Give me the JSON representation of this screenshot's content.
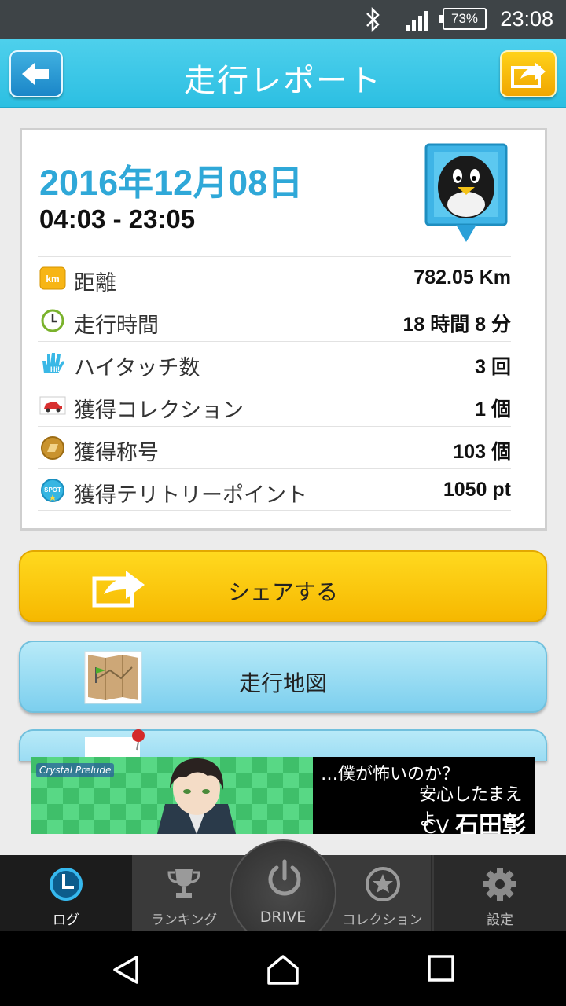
{
  "status_bar": {
    "battery": "73%",
    "time": "23:08"
  },
  "header": {
    "title": "走行レポート"
  },
  "report": {
    "date": "2016年12月08日",
    "time_range": "04:03 - 23:05",
    "stats": [
      {
        "icon": "km-icon",
        "label": "距離",
        "value": "782.05 Km"
      },
      {
        "icon": "clock-icon",
        "label": "走行時間",
        "value": "18 時間 8 分"
      },
      {
        "icon": "hi-hand-icon",
        "label": "ハイタッチ数",
        "value": "3 回"
      },
      {
        "icon": "car-collection-icon",
        "label": "獲得コレクション",
        "value": "1 個"
      },
      {
        "icon": "medal-icon",
        "label": "獲得称号",
        "value": "103 個"
      },
      {
        "icon": "spot-icon",
        "label": "獲得テリトリーポイント",
        "value": "1050 pt"
      }
    ]
  },
  "buttons": {
    "share": "シェアする",
    "map": "走行地図"
  },
  "ad": {
    "logo": "Crystal Prelude",
    "line1": "…僕が怖いのか？",
    "line2": "安心したまえよ",
    "cv_prefix": "CV",
    "cv_name": "石田彰"
  },
  "bottom_nav": {
    "log": "ログ",
    "ranking": "ランキング",
    "drive": "DRIVE",
    "collection": "コレクション",
    "settings": "設定"
  },
  "colors": {
    "header": "#2cbfe2",
    "date_blue": "#2fa8d8",
    "share_yellow": "#f6b800",
    "map_blue": "#7ccfee",
    "nav_dark": "#3a3a3a"
  }
}
